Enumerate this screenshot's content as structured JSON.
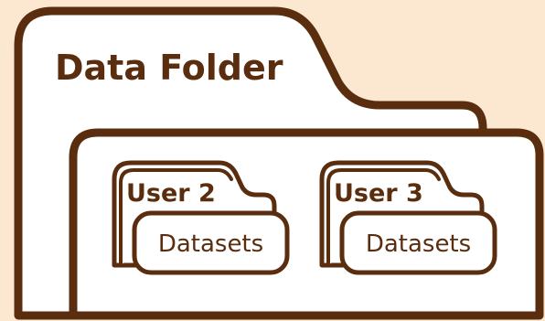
{
  "title": "Data Folder",
  "users": [
    {
      "label": "User 2",
      "child": "Datasets"
    },
    {
      "label": "User 3",
      "child": "Datasets"
    }
  ],
  "colors": {
    "background": "#FCE7D0",
    "stroke": "#5A2D0E",
    "fill": "#FFFFFF"
  },
  "icons": [
    "folder-icon",
    "folder-icon",
    "folder-icon"
  ]
}
